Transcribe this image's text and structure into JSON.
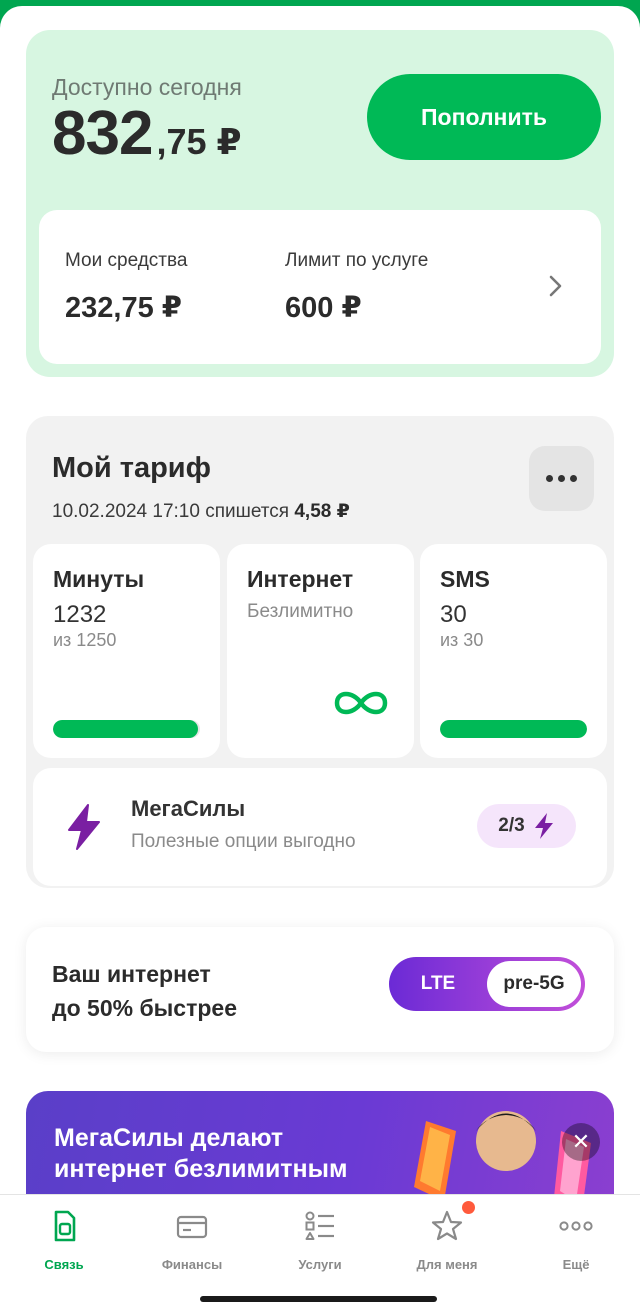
{
  "balance": {
    "label": "Доступно сегодня",
    "amount_int": "832",
    "amount_frac": ",75 ₽",
    "topup_label": "Пополнить",
    "funds_label": "Мои средства",
    "funds_value": "232,75 ₽",
    "limit_label": "Лимит по услуге",
    "limit_value": "600 ₽"
  },
  "tariff": {
    "title": "Мой тариф",
    "charge_text": "10.02.2024 17:10 спишется",
    "charge_amount": "4,58 ₽",
    "minutes": {
      "title": "Минуты",
      "value": "1232",
      "total": "из 1250",
      "progress": 0.9856
    },
    "internet": {
      "title": "Интернет",
      "value": "Безлимитно"
    },
    "sms": {
      "title": "SMS",
      "value": "30",
      "total": "из 30",
      "progress": 1.0
    },
    "mega": {
      "title": "МегаСилы",
      "subtitle": "Полезные опции выгодно",
      "badge": "2/3"
    }
  },
  "network": {
    "line1": "Ваш интернет",
    "line2": "до 50% быстрее",
    "opt_lte": "LTE",
    "opt_5g": "pre-5G"
  },
  "promo": {
    "line1": "МегаСилы делают",
    "line2": "интернет безлимитным"
  },
  "nav": {
    "items": [
      {
        "label": "Связь",
        "icon": "sim-icon"
      },
      {
        "label": "Финансы",
        "icon": "wallet-icon"
      },
      {
        "label": "Услуги",
        "icon": "services-list-icon"
      },
      {
        "label": "Для меня",
        "icon": "star-icon"
      },
      {
        "label": "Ещё",
        "icon": "more-dots-icon"
      }
    ]
  },
  "colors": {
    "accent": "#00b956",
    "card_bg": "#d7f6e1",
    "purple": "#6b2ad6",
    "badge_dot": "#ff5a3c"
  }
}
